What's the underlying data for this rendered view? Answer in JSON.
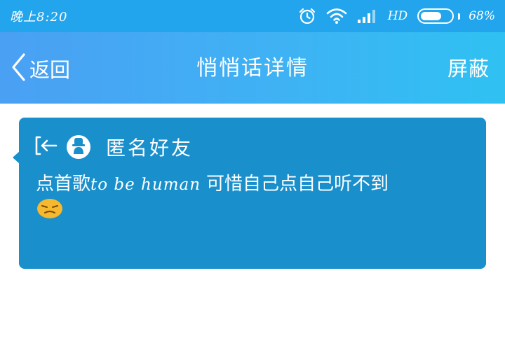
{
  "status_bar": {
    "time": "晚上8:20",
    "network_label": "HD",
    "battery_percent": "68%",
    "battery_level": 0.68,
    "icons": [
      "alarm-icon",
      "wifi-icon",
      "signal-icon",
      "battery-icon"
    ]
  },
  "header": {
    "back_label": "返回",
    "title": "悄悄话详情",
    "block_label": "屏蔽"
  },
  "message": {
    "sender": "匿名好友",
    "text_cn_1": "点首歌",
    "text_latin": "to be human",
    "text_cn_2": "可惜自己点自己听不到",
    "emoji": "sad-face-emoji"
  },
  "colors": {
    "status_bar": "#22a5ec",
    "header_start": "#4aa0f3",
    "header_end": "#2fc1f2",
    "card": "#198fcc",
    "emoji": "#f5b82e"
  }
}
